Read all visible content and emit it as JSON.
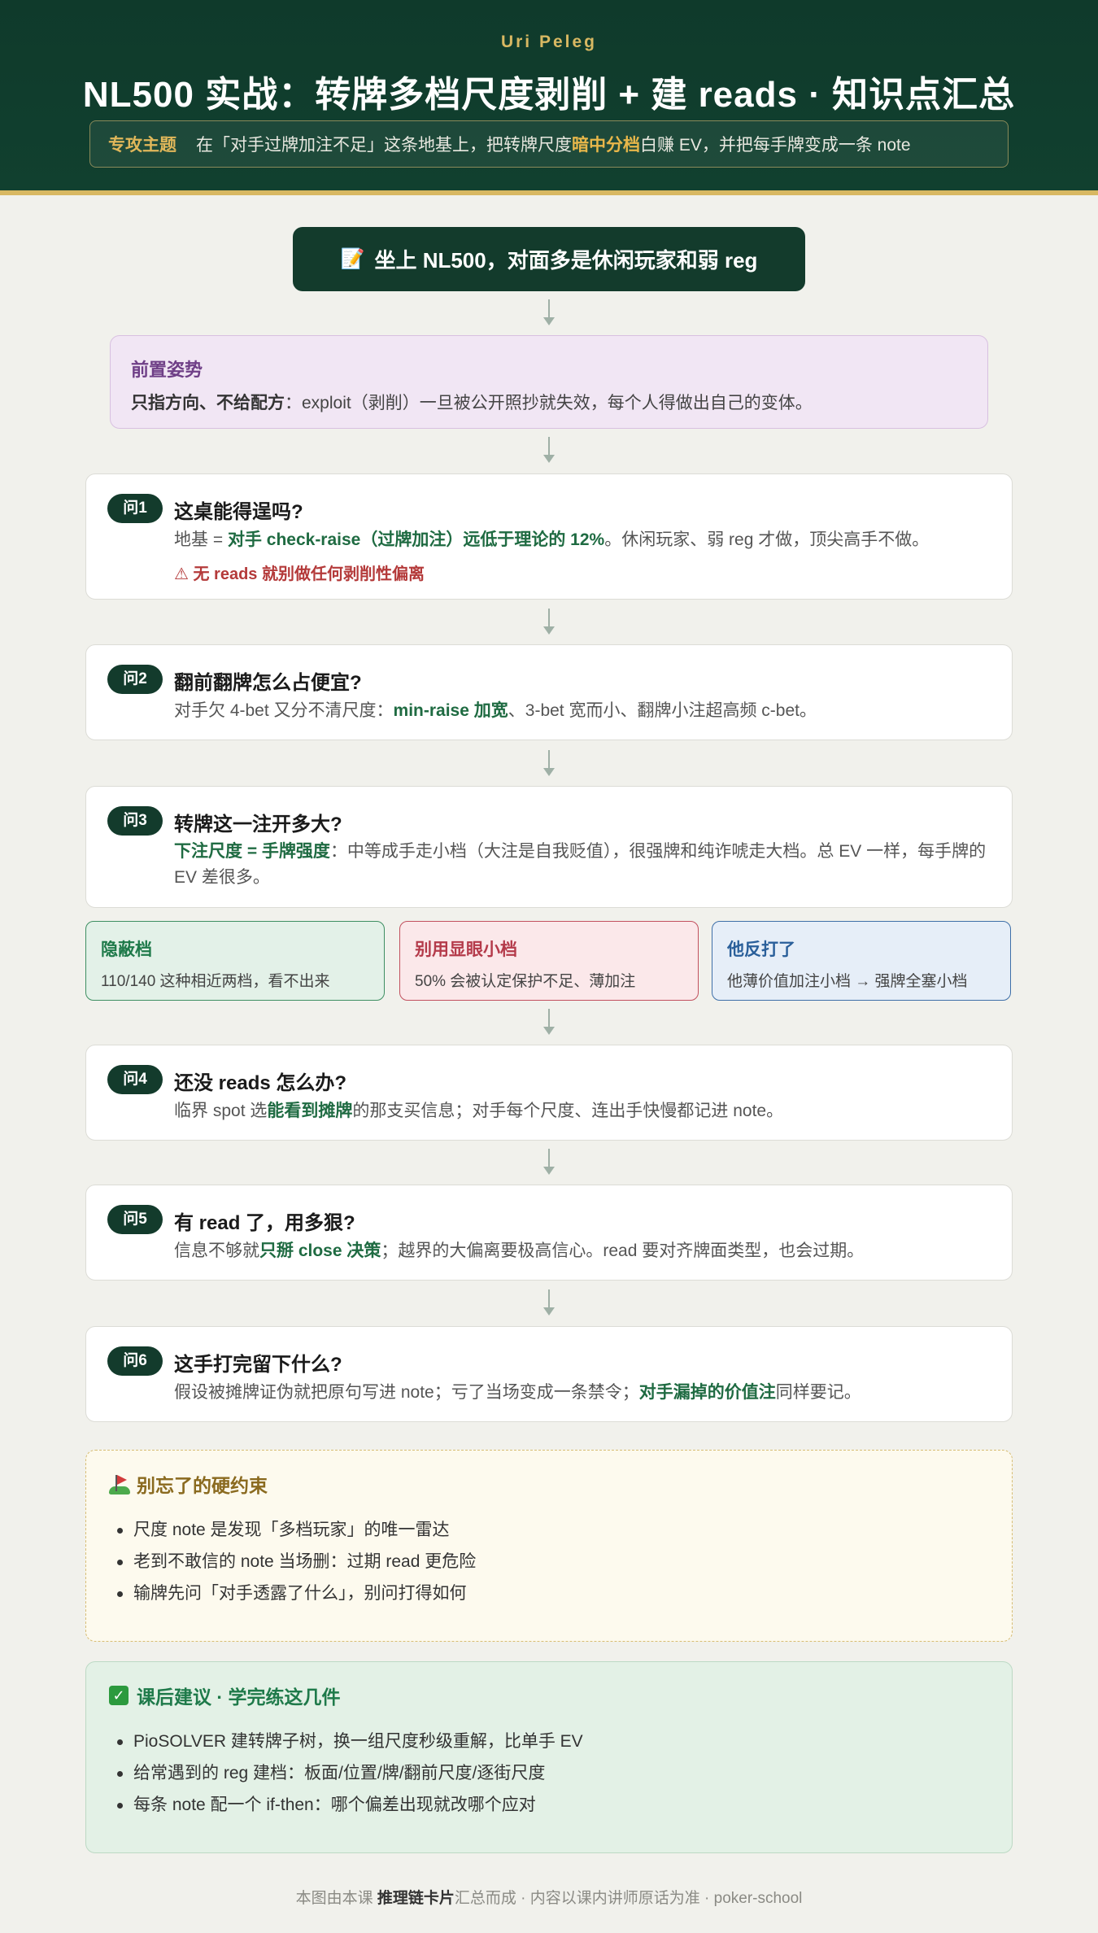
{
  "header": {
    "author": "Uri Peleg",
    "title": "NL500 实战：转牌多档尺度剥削 + 建 reads · 知识点汇总",
    "focus_tag": "专攻主题",
    "focus_pre": "在「对手过牌加注不足」这条地基上，把转牌尺度",
    "focus_hl": "暗中分档",
    "focus_post": "白赚 EV，并把每手牌变成一条 note"
  },
  "start": {
    "icon": "memo-icon",
    "label": "坐上 NL500，对面多是休闲玩家和弱 reg"
  },
  "pre": {
    "title": "前置姿势",
    "bold": "只指方向、不给配方",
    "text": "：exploit（剥削）一旦被公开照抄就失效，每个人得做出自己的变体。"
  },
  "questions": [
    {
      "badge": "问1",
      "title": "这桌能得逞吗?",
      "t1": "地基 = ",
      "g1": "对手 check-raise（过牌加注）远低于理论的 12%",
      "t2": "。休闲玩家、弱 reg 才做，顶尖高手不做。",
      "warn": "⚠ 无 reads 就别做任何剥削性偏离"
    },
    {
      "badge": "问2",
      "title": "翻前翻牌怎么占便宜?",
      "t1": "对手欠 4-bet 又分不清尺度：",
      "g1": "min-raise 加宽",
      "t2": "、3-bet 宽而小、翻牌小注超高频 c-bet。"
    },
    {
      "badge": "问3",
      "title": "转牌这一注开多大?",
      "g1": "下注尺度 = 手牌强度",
      "t2": "：中等成手走小档（大注是自我贬值），很强牌和纯诈唬走大档。总 EV 一样，每手牌的 EV 差很多。"
    },
    {
      "badge": "问4",
      "title": "还没 reads 怎么办?",
      "t1": "临界 spot 选",
      "g1": "能看到摊牌",
      "t2": "的那支买信息；对手每个尺度、连出手快慢都记进 note。"
    },
    {
      "badge": "问5",
      "title": "有 read 了，用多狠?",
      "t1": "信息不够就",
      "g1": "只掰 close 决策",
      "t2": "；越界的大偏离要极高信心。read 要对齐牌面类型，也会过期。"
    },
    {
      "badge": "问6",
      "title": "这手打完留下什么?",
      "t1": "假设被摊牌证伪就把原句写进 note；亏了当场变成一条禁令；",
      "g1": "对手漏掉的价值注",
      "t2": "同样要记。"
    }
  ],
  "tiers": [
    {
      "title": "隐蔽档",
      "text": "110/140 这种相近两档，看不出来"
    },
    {
      "title": "别用显眼小档",
      "text": "50% 会被认定保护不足、薄加注"
    },
    {
      "title": "他反打了",
      "text": "他薄价值加注小档 → 强牌全塞小档"
    }
  ],
  "constraints": {
    "icon": "golf-flag-icon",
    "title": "别忘了的硬约束",
    "items": [
      "尺度 note 是发现「多档玩家」的唯一雷达",
      "老到不敢信的 note 当场删：过期 read 更危险",
      "输牌先问「对手透露了什么」，别问打得如何"
    ]
  },
  "advice": {
    "icon": "check-mark-icon",
    "title": "课后建议 · 学完练这几件",
    "items": [
      "PioSOLVER 建转牌子树，换一组尺度秒级重解，比单手 EV",
      "给常遇到的 reg 建档：板面/位置/牌/翻前尺度/逐街尺度",
      "每条 note 配一个 if-then：哪个偏差出现就改哪个应对"
    ]
  },
  "footer": {
    "pre": "本图由本课 ",
    "bold": "推理链卡片",
    "post": "汇总而成 · 内容以课内讲师原话为准 · poker-school"
  }
}
